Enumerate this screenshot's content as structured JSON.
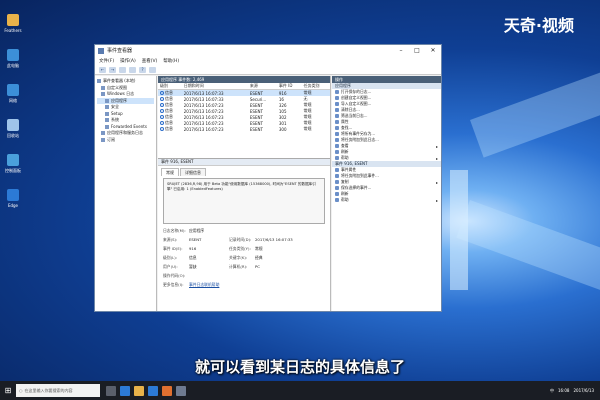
{
  "watermark": "天奇·视频",
  "subtitle": "就可以看到某日志的具体信息了",
  "desktop_icons": [
    {
      "name": "Feathers",
      "color": "#e8b24a"
    },
    {
      "name": "此电脑",
      "color": "#3c8fd8"
    },
    {
      "name": "网络",
      "color": "#3c8fd8"
    },
    {
      "name": "回收站",
      "color": "#9fc4ea"
    },
    {
      "name": "控制面板",
      "color": "#4aa0dc"
    },
    {
      "name": "Edge",
      "color": "#2c7ad6"
    }
  ],
  "window": {
    "title": "事件查看器",
    "menu": [
      "文件(F)",
      "操作(A)",
      "查看(V)",
      "帮助(H)"
    ]
  },
  "tree": {
    "items": [
      {
        "label": "事件查看器 (本地)",
        "selected": false
      },
      {
        "label": "自定义视图",
        "selected": false
      },
      {
        "label": "Windows 日志",
        "selected": false
      },
      {
        "label": "应用程序",
        "selected": true
      },
      {
        "label": "安全",
        "selected": false
      },
      {
        "label": "Setup",
        "selected": false
      },
      {
        "label": "系统",
        "selected": false
      },
      {
        "label": "Forwarded Events",
        "selected": false
      },
      {
        "label": "应用程序和服务日志",
        "selected": false
      },
      {
        "label": "订阅",
        "selected": false
      }
    ]
  },
  "events": {
    "header": "应用程序   事件数: 2,469",
    "columns": [
      "级别",
      "日期和时间",
      "来源",
      "事件 ID",
      "任务类别"
    ],
    "rows": [
      [
        "信息",
        "2017/6/13 16:07:33",
        "ESENT",
        "916",
        "常规"
      ],
      [
        "信息",
        "2017/6/13 16:07:33",
        "Securi...",
        "16",
        "无"
      ],
      [
        "信息",
        "2017/6/13 16:07:23",
        "ESENT",
        "326",
        "常规"
      ],
      [
        "信息",
        "2017/6/13 16:07:23",
        "ESENT",
        "105",
        "常规"
      ],
      [
        "信息",
        "2017/6/13 16:07:23",
        "ESENT",
        "302",
        "常规"
      ],
      [
        "信息",
        "2017/6/13 16:07:23",
        "ESENT",
        "301",
        "常规"
      ],
      [
        "信息",
        "2017/6/13 16:07:23",
        "ESENT",
        "300",
        "常规"
      ]
    ],
    "selected_row": 0
  },
  "detail": {
    "header": "事件 916, ESENT",
    "tabs": [
      "常规",
      "详细信息"
    ],
    "message": "SRUJET (2836,R,98) 用于 Beta 功能\"使用数据库 (15368000), 时间为\"ESENT 的数据库引擎\"\n已启用: 1 (EnabledFeatures)",
    "props": [
      {
        "k": "日志名称(M):",
        "v": "应用程序",
        "k2": "",
        "v2": ""
      },
      {
        "k": "来源(S):",
        "v": "ESENT",
        "k2": "记录时间(D):",
        "v2": "2017/6/13 16:07:33"
      },
      {
        "k": "事件 ID(E):",
        "v": "916",
        "k2": "任务类别(Y):",
        "v2": "常规"
      },
      {
        "k": "级别(L):",
        "v": "信息",
        "k2": "关键字(K):",
        "v2": "经典"
      },
      {
        "k": "用户(U):",
        "v": "暂缺",
        "k2": "计算机(R):",
        "v2": "PC"
      },
      {
        "k": "操作代码(O):",
        "v": "",
        "k2": "",
        "v2": ""
      },
      {
        "k": "更多信息(I):",
        "v": "事件日志联机帮助",
        "k2": "",
        "v2": "",
        "link": true
      }
    ]
  },
  "actions": {
    "header": "操作",
    "group1": "应用程序",
    "items1": [
      {
        "label": "打开保存的日志...",
        "arrow": false
      },
      {
        "label": "创建自定义视图...",
        "arrow": false
      },
      {
        "label": "导入自定义视图...",
        "arrow": false
      },
      {
        "label": "清除日志...",
        "arrow": false
      },
      {
        "label": "筛选当前日志...",
        "arrow": false
      },
      {
        "label": "属性",
        "arrow": false
      },
      {
        "label": "查找...",
        "arrow": false
      },
      {
        "label": "将所有事件另存为...",
        "arrow": false
      },
      {
        "label": "将任务附加到此日志...",
        "arrow": false
      },
      {
        "label": "查看",
        "arrow": true
      },
      {
        "label": "刷新",
        "arrow": false
      },
      {
        "label": "帮助",
        "arrow": true
      }
    ],
    "group2": "事件 916, ESENT",
    "items2": [
      {
        "label": "事件属性",
        "arrow": false
      },
      {
        "label": "将任务附加到此事件...",
        "arrow": false
      },
      {
        "label": "复制",
        "arrow": true
      },
      {
        "label": "保存选择的事件...",
        "arrow": false
      },
      {
        "label": "刷新",
        "arrow": false
      },
      {
        "label": "帮助",
        "arrow": true
      }
    ]
  },
  "taskbar": {
    "search_placeholder": "在这里输入你要搜索的内容",
    "tray_lang": "中",
    "time": "16:08",
    "date": "2017/6/13"
  }
}
